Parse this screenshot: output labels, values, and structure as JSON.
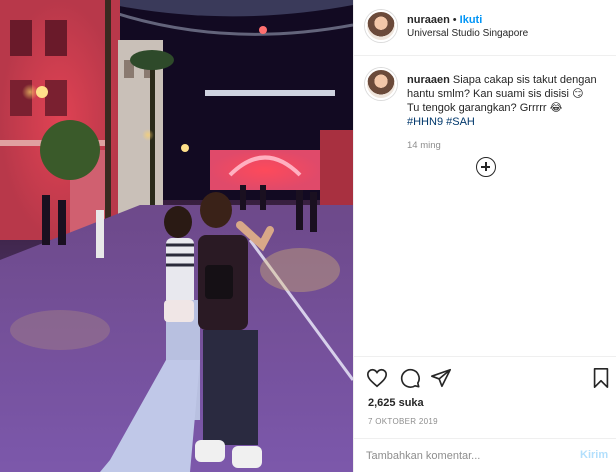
{
  "post": {
    "username": "nuraaen",
    "follow_separator": "•",
    "follow_label": "Ikuti",
    "location": "Universal Studio Singapore"
  },
  "caption": {
    "username": "nuraaen",
    "line1": "Siapa cakap sis takut dengan hantu smlm? Kan suami sis disisi",
    "emoji1": "😏",
    "line2": "Tu tengok garangkan? Grrrrr",
    "emoji2": "😂",
    "hashtags": [
      "#HHN9",
      "#SAH"
    ],
    "time_ago": "14 ming"
  },
  "actions": {
    "icons": [
      "heart-icon",
      "comment-icon",
      "share-icon",
      "bookmark-icon"
    ],
    "likes": "2,625 suka",
    "date": "7 OKTOBER 2019"
  },
  "comment_box": {
    "placeholder": "Tambahkan komentar...",
    "post_label": "Kirim"
  },
  "colors": {
    "accent": "#0095f6",
    "hashtag": "#00376b",
    "muted": "#8e8e8e",
    "post_disabled": "#b2dffc"
  }
}
